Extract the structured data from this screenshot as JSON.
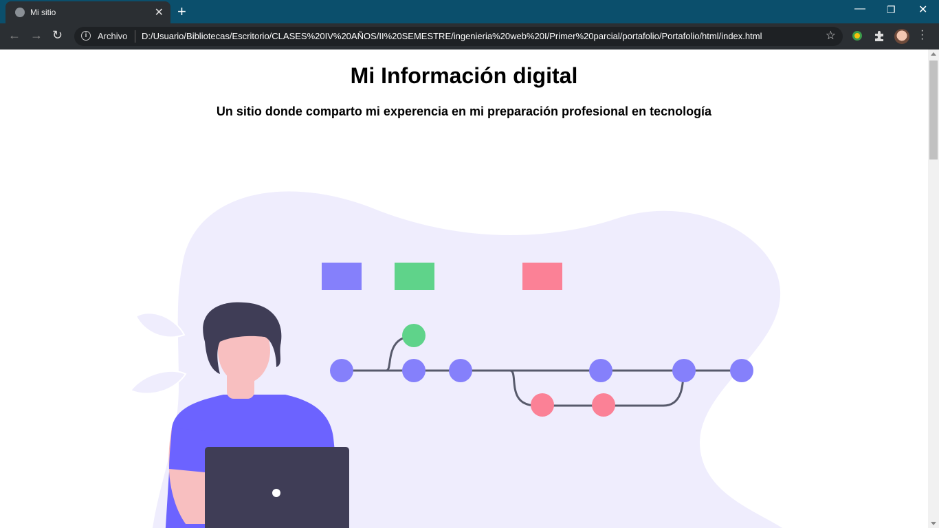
{
  "browser": {
    "tab_title": "Mi sitio",
    "tab_close_icon": "close-icon",
    "new_tab_icon": "plus-icon",
    "address_scheme_label": "Archivo",
    "url": "D:/Usuario/Bibliotecas/Escritorio/CLASES%20IV%20AÑOS/II%20SEMESTRE/ingenieria%20web%20I/Primer%20parcial/portafolio/Portafolio/html/index.html"
  },
  "page": {
    "title": "Mi Información digital",
    "subtitle": "Un sitio donde comparto mi experencia en mi preparación profesional en tecnología"
  },
  "colors": {
    "chrome_title_bg": "#0b4f6c",
    "chrome_toolbar_bg": "#2b2f33",
    "blob": "#efedfd",
    "purple": "#8580fb",
    "green": "#5fd38a",
    "pink": "#fb8196",
    "dark": "#3f3d56",
    "skin": "#f8bfc0",
    "shirt": "#6c63ff"
  }
}
